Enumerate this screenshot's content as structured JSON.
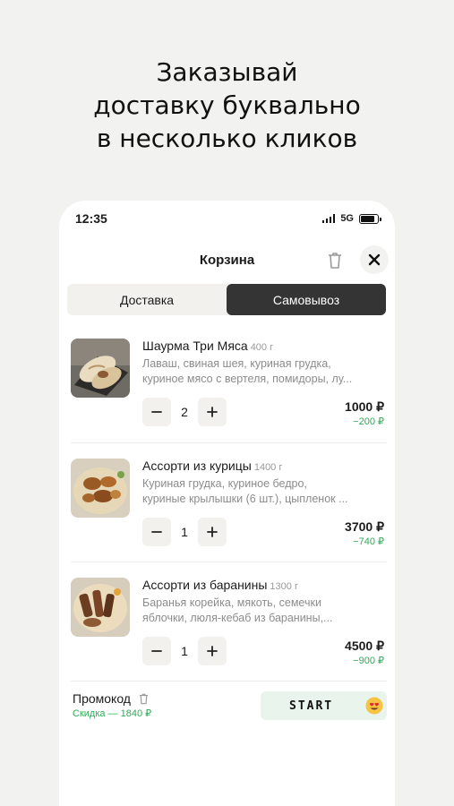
{
  "headline": {
    "line1": "Заказывай",
    "line2": "доставку буквально",
    "line3": "в несколько кликов"
  },
  "status": {
    "time": "12:35",
    "network": "5G"
  },
  "cart": {
    "title": "Корзина"
  },
  "tabs": [
    {
      "label": "Доставка",
      "active": false
    },
    {
      "label": "Самовывоз",
      "active": true
    }
  ],
  "items": [
    {
      "name": "Шаурма Три Мяса",
      "weight": "400 г",
      "desc1": "Лаваш, свиная шея, куриная грудка,",
      "desc2": "куриное мясо с вертеля, помидоры, лу...",
      "qty": "2",
      "price": "1000 ₽",
      "discount": "−200 ₽"
    },
    {
      "name": "Ассорти из курицы",
      "weight": "1400 г",
      "desc1": "Куриная грудка, куриное бедро,",
      "desc2": "куриные крылышки (6 шт.), цыпленок ...",
      "qty": "1",
      "price": "3700 ₽",
      "discount": "−740 ₽"
    },
    {
      "name": "Ассорти из баранины",
      "weight": "1300 г",
      "desc1": "Баранья корейка, мякоть, семечки",
      "desc2": "яблочки, люля-кебаб из баранины,...",
      "qty": "1",
      "price": "4500 ₽",
      "discount": "−900 ₽"
    }
  ],
  "promo": {
    "label": "Промокод",
    "discount": "Скидка — 1840 ₽",
    "code": "START",
    "emoji": "heart-eyes-emoji"
  },
  "colors": {
    "accent_green": "#2fab57",
    "dark": "#343434",
    "promo_bg": "#e8f4ec"
  }
}
